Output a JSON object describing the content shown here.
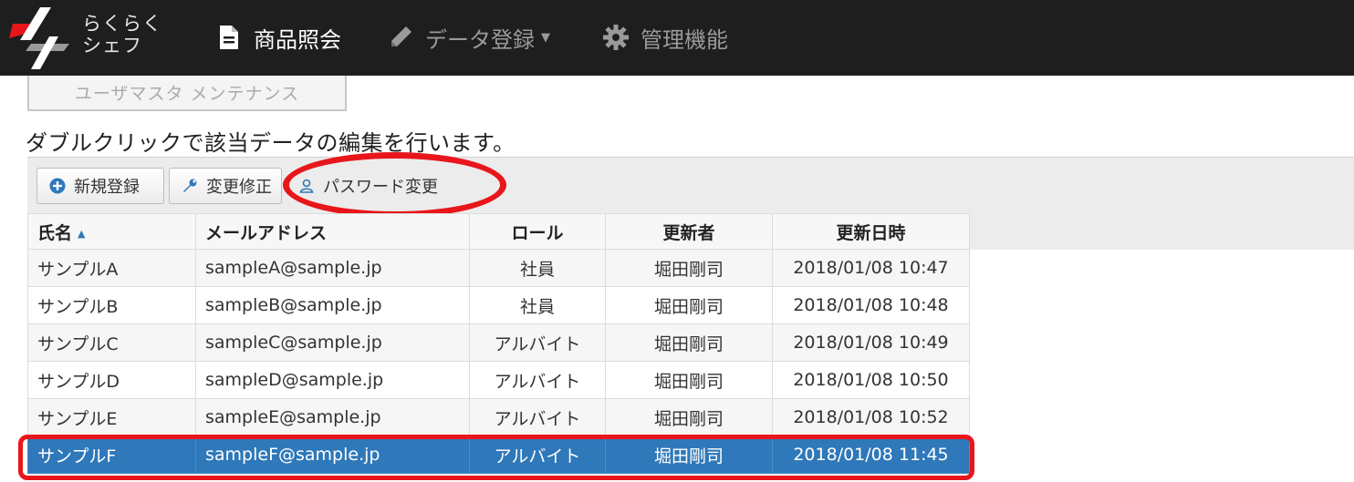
{
  "navbar": {
    "logo_line1": "らくらく",
    "logo_line2": "シェフ",
    "items": [
      {
        "label": "商品照会",
        "icon": "file-icon",
        "active": true
      },
      {
        "label": "データ登録",
        "icon": "pencil-icon",
        "has_dropdown": true
      },
      {
        "label": "管理機能",
        "icon": "gear-icon"
      }
    ]
  },
  "tab_button": {
    "label": "ユーザマスタ メンテナンス"
  },
  "instruction": "ダブルクリックで該当データの編集を行います。",
  "toolbar": {
    "new_label": "新規登録",
    "edit_label": "変更修正",
    "password_label": "パスワード変更"
  },
  "grid": {
    "columns": [
      "氏名",
      "メールアドレス",
      "ロール",
      "更新者",
      "更新日時"
    ],
    "sort_column": "氏名",
    "sort_direction": "asc",
    "rows": [
      {
        "name": "サンプルA",
        "email": "sampleA@sample.jp",
        "role": "社員",
        "updater": "堀田剛司",
        "updated": "2018/01/08 10:47"
      },
      {
        "name": "サンプルB",
        "email": "sampleB@sample.jp",
        "role": "社員",
        "updater": "堀田剛司",
        "updated": "2018/01/08 10:48"
      },
      {
        "name": "サンプルC",
        "email": "sampleC@sample.jp",
        "role": "アルバイト",
        "updater": "堀田剛司",
        "updated": "2018/01/08 10:49"
      },
      {
        "name": "サンプルD",
        "email": "sampleD@sample.jp",
        "role": "アルバイト",
        "updater": "堀田剛司",
        "updated": "2018/01/08 10:50"
      },
      {
        "name": "サンプルE",
        "email": "sampleE@sample.jp",
        "role": "アルバイト",
        "updater": "堀田剛司",
        "updated": "2018/01/08 10:52"
      },
      {
        "name": "サンプルF",
        "email": "sampleF@sample.jp",
        "role": "アルバイト",
        "updater": "堀田剛司",
        "updated": "2018/01/08 11:45"
      }
    ],
    "selected_row": 5
  },
  "colors": {
    "navbar_bg": "#1e1e1e",
    "selected_row_bg": "#2f78b9",
    "annotation_red": "#e8161b"
  }
}
